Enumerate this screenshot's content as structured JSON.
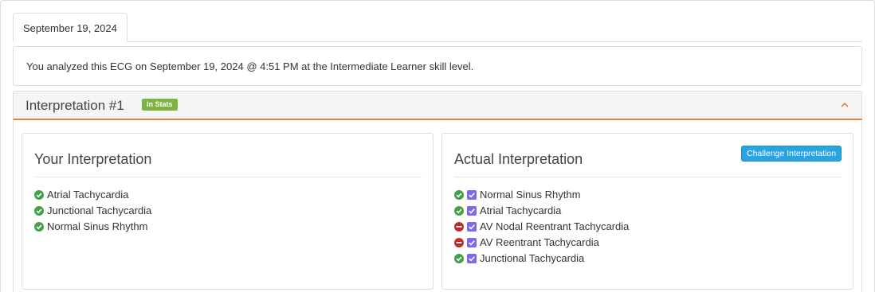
{
  "tabs": [
    {
      "label": "September 19, 2024"
    }
  ],
  "info": {
    "text": "You analyzed this ECG on September 19, 2024 @ 4:51 PM at the Intermediate Learner skill level."
  },
  "interpretation": {
    "title": "Interpretation #1",
    "badge": "In Stats",
    "accent_color": "#e0853c",
    "badge_color": "#7cb342"
  },
  "your_interpretation": {
    "heading": "Your Interpretation",
    "items": [
      {
        "label": "Atrial Tachycardia",
        "status": "correct"
      },
      {
        "label": "Junctional Tachycardia",
        "status": "correct"
      },
      {
        "label": "Normal Sinus Rhythm",
        "status": "correct"
      }
    ]
  },
  "actual_interpretation": {
    "heading": "Actual Interpretation",
    "challenge_label": "Challenge Interpretation",
    "items": [
      {
        "label": "Normal Sinus Rhythm",
        "status": "correct",
        "checked": true
      },
      {
        "label": "Atrial Tachycardia",
        "status": "correct",
        "checked": true
      },
      {
        "label": "AV Nodal Reentrant Tachycardia",
        "status": "missed",
        "checked": true
      },
      {
        "label": "AV Reentrant Tachycardia",
        "status": "missed",
        "checked": true
      },
      {
        "label": "Junctional Tachycardia",
        "status": "correct",
        "checked": true
      }
    ]
  }
}
